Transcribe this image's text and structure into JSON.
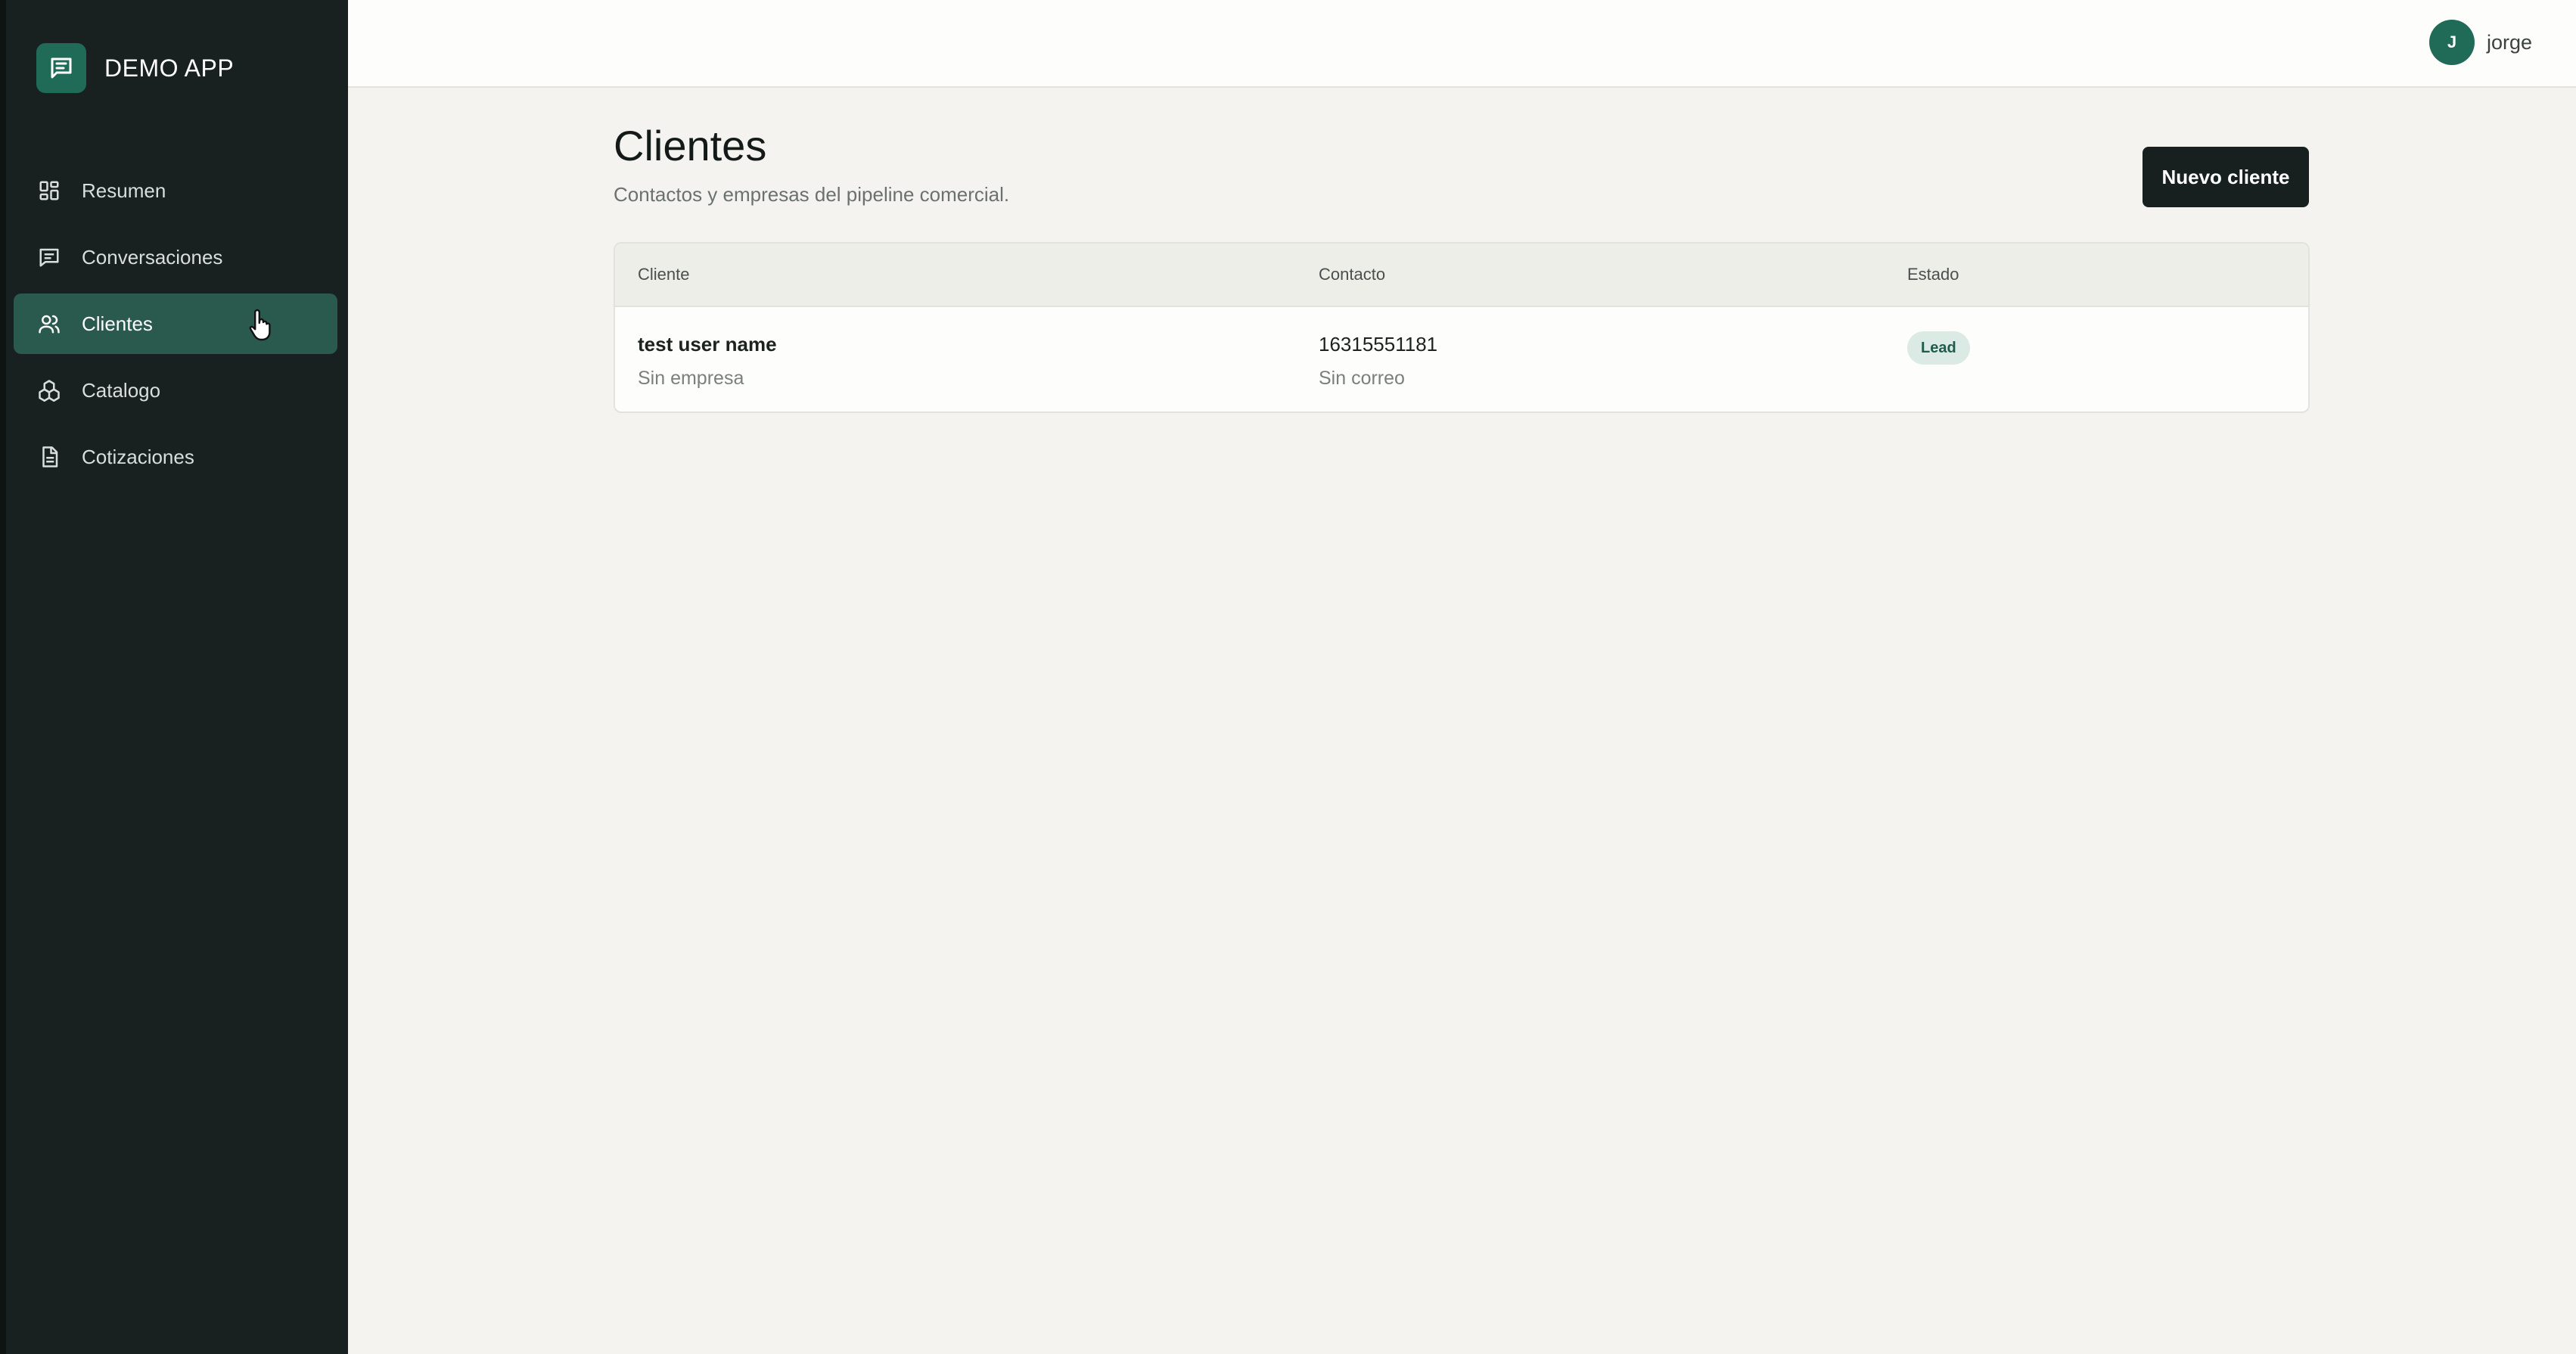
{
  "brand": {
    "name": "DEMO APP",
    "icon": "chat-icon",
    "accent": "#1f6b58"
  },
  "sidebar": {
    "items": [
      {
        "label": "Resumen",
        "icon": "dashboard-grid-icon",
        "active": false
      },
      {
        "label": "Conversaciones",
        "icon": "message-icon",
        "active": false
      },
      {
        "label": "Clientes",
        "icon": "users-icon",
        "active": true
      },
      {
        "label": "Catalogo",
        "icon": "cubes-icon",
        "active": false
      },
      {
        "label": "Cotizaciones",
        "icon": "document-icon",
        "active": false
      }
    ]
  },
  "user": {
    "initial": "J",
    "name": "jorge"
  },
  "page": {
    "title": "Clientes",
    "subtitle": "Contactos y empresas del pipeline comercial.",
    "new_button": "Nuevo cliente"
  },
  "table": {
    "headers": [
      "Cliente",
      "Contacto",
      "Estado"
    ],
    "rows": [
      {
        "name": "test user name",
        "company": "Sin empresa",
        "phone": "16315551181",
        "email": "Sin correo",
        "status": "Lead"
      }
    ]
  },
  "colors": {
    "sidebar_bg": "#18211f",
    "active_item": "#2a5a4d",
    "badge_bg": "#dbeae4",
    "badge_text": "#1f5c4c"
  }
}
